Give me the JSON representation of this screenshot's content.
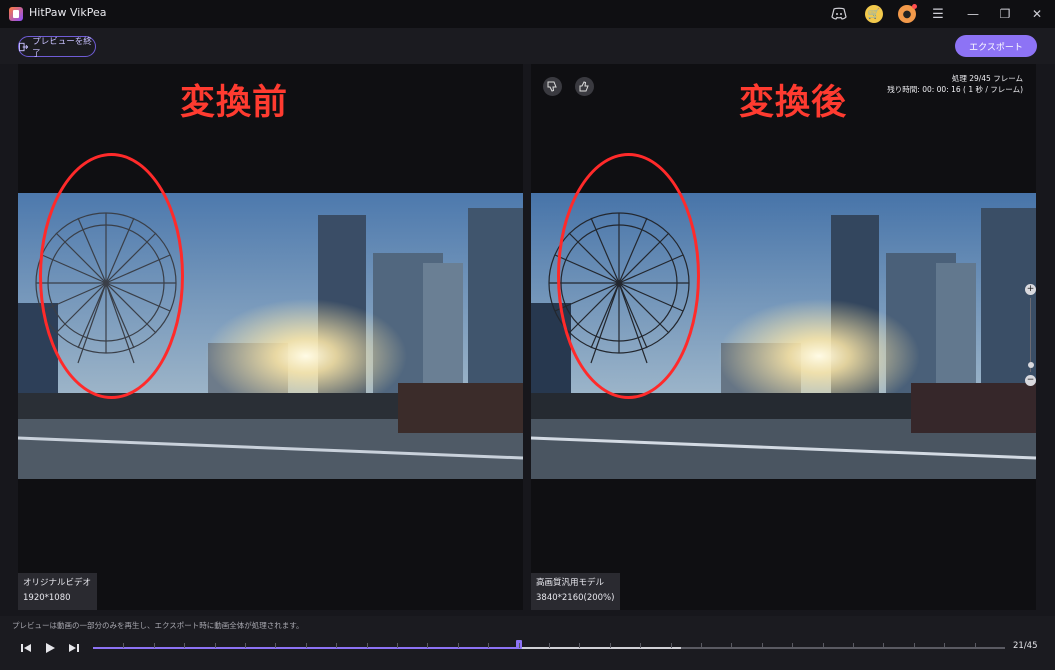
{
  "app": {
    "title": "HitPaw VikPea"
  },
  "titlebar_icons": [
    "discord-icon",
    "cart-icon",
    "account-icon",
    "menu-icon",
    "minimize-icon",
    "restore-icon",
    "close-icon"
  ],
  "toolbar": {
    "exit_label": "プレビューを終了",
    "export_label": "エクスポート"
  },
  "left_panel": {
    "annotation": "変換前",
    "model_label": "オリジナルビデオ",
    "resolution": "1920*1080"
  },
  "right_panel": {
    "annotation": "変換後",
    "model_label": "高画質汎用モデル",
    "resolution": "3840*2160(200%)",
    "progress_line1": "処理 29/45 フレーム",
    "progress_line2": "残り時間: 00: 00: 16 ( 1 秒 / フレーム)"
  },
  "zoom": {
    "plus": "+",
    "minus": "−",
    "level": 0.1
  },
  "bottom": {
    "hint": "プレビューは動画の一部分のみを再生し、エクスポート時に動画全体が処理されます。",
    "frame_counter": "21/45",
    "current_frame": 21,
    "processed_frames": 29,
    "total_frames": 45
  },
  "colors": {
    "accent": "#8d73f5",
    "annotation_red": "#ff3b30"
  }
}
